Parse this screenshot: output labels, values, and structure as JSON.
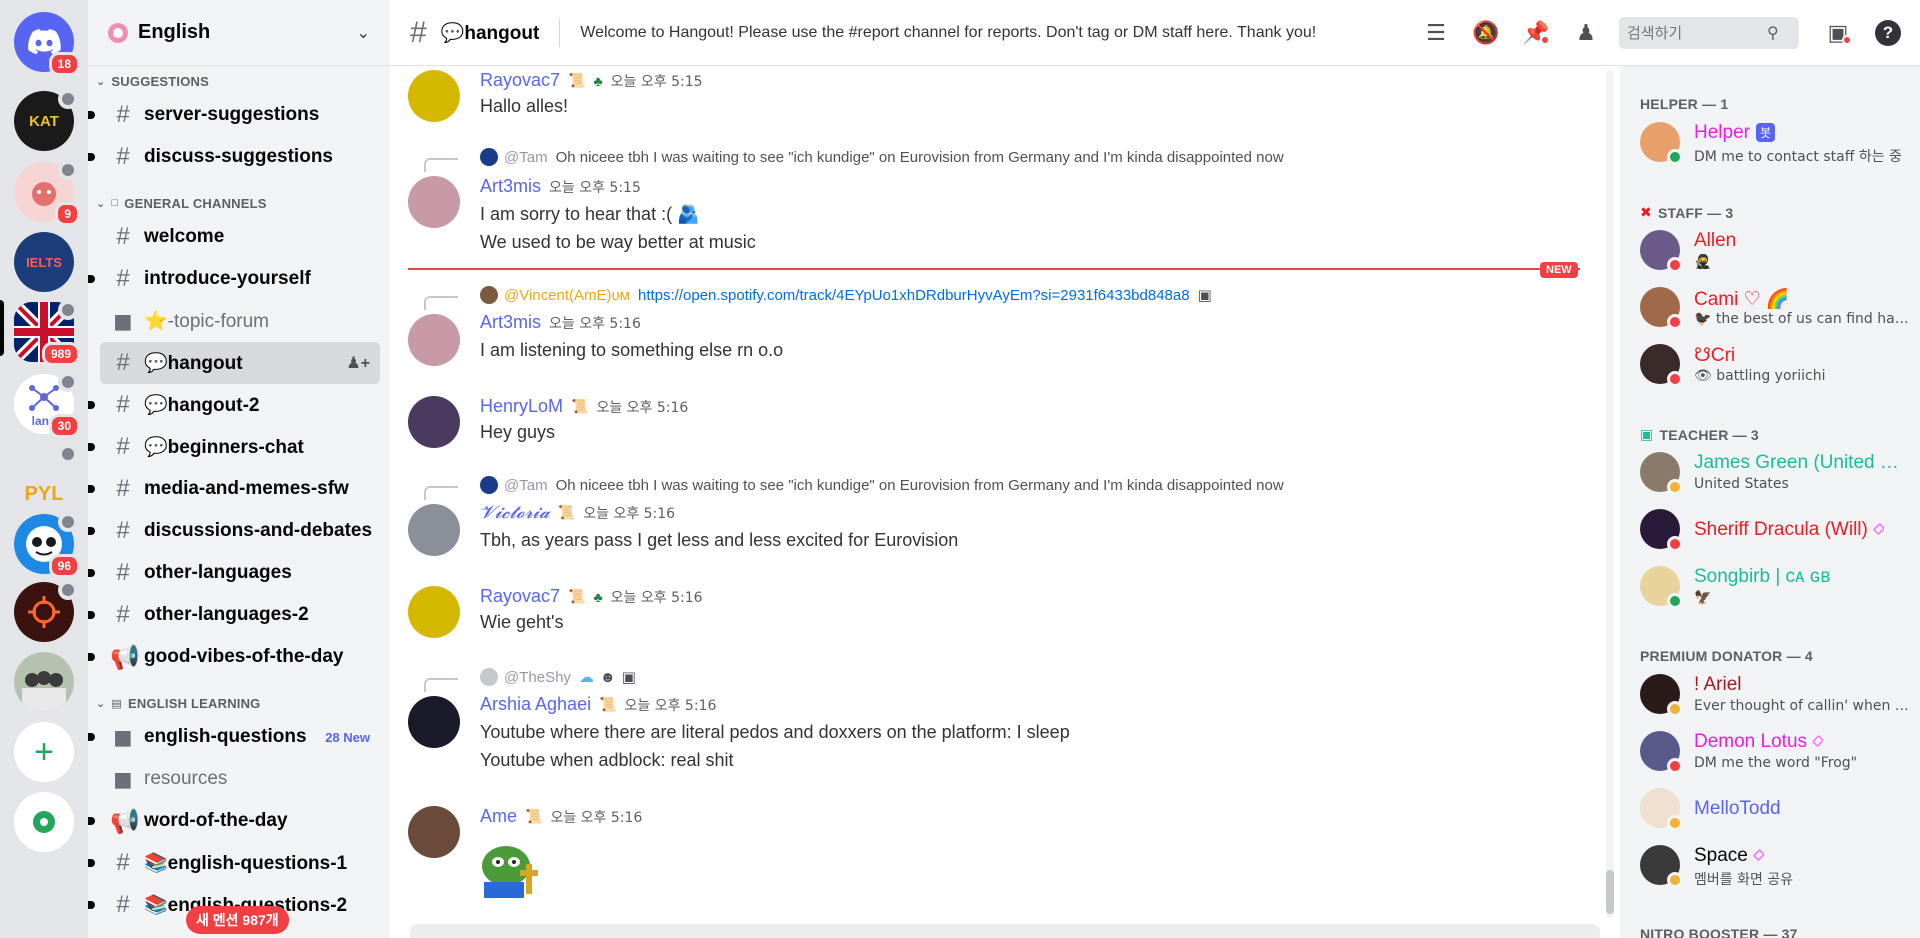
{
  "servers": {
    "home_badge": "18",
    "items": [
      {
        "badge": "",
        "label": "KAT"
      },
      {
        "badge": "9",
        "label": ""
      },
      {
        "badge": "",
        "label": "IELTS"
      },
      {
        "badge": "989",
        "label": ""
      },
      {
        "badge": "30",
        "label": "lang"
      },
      {
        "badge": "",
        "label": "PYL"
      },
      {
        "badge": "96",
        "label": ""
      },
      {
        "badge": "",
        "label": ""
      },
      {
        "badge": "",
        "label": ""
      }
    ]
  },
  "guild": {
    "name": "English"
  },
  "sidebar": {
    "categories": {
      "suggestions": "SUGGESTIONS",
      "general": "GENERAL CHANNELS",
      "learning": "ENGLISH LEARNING"
    },
    "channels": {
      "server_suggestions": "server-suggestions",
      "discuss_suggestions": "discuss-suggestions",
      "welcome": "welcome",
      "introduce": "introduce-yourself",
      "topic_forum": "⭐-topic-forum",
      "hangout": "💬hangout",
      "hangout2": "💬hangout-2",
      "beginners": "💬beginners-chat",
      "media": "media-and-memes-sfw",
      "discussions": "discussions-and-debates",
      "other_lang": "other-languages",
      "other_lang2": "other-languages-2",
      "good_vibes": "good-vibes-of-the-day",
      "english_questions": "english-questions",
      "english_questions_new": "28 New",
      "resources": "resources",
      "word_of_day": "word-of-the-day",
      "english_questions_1": "📚english-questions-1",
      "english_questions_2": "📚english-questions-2"
    },
    "mention_pill": "새 멘션 987개"
  },
  "header": {
    "channel": "💬hangout",
    "topic": "Welcome to Hangout! Please use the #report channel for reports. Don't tag or DM staff here. Thank you!",
    "search_placeholder": "검색하기"
  },
  "messages": [
    {
      "author": "Rayovac7",
      "time": "오늘 오후 5:15",
      "color": "#5865f2",
      "lines": [
        "Hallo alles!"
      ]
    },
    {
      "reply_to": "@Tam",
      "reply_text": "Oh niceee tbh I was waiting to see \"ich kundige\" on Eurovision from Germany and I'm kinda disappointed now",
      "author": "Art3mis",
      "time": "오늘 오후 5:15",
      "color": "#5865f2",
      "lines": [
        "I am sorry to hear that :( 🫂",
        "We used to be way better at music"
      ]
    },
    {
      "reply_to": "@Vincent(AmE)ᴜᴍ",
      "reply_link": "https://open.spotify.com/track/4EYpUo1xhDRdburHyvAyEm?si=2931f6433bd848a8",
      "author": "Art3mis",
      "time": "오늘 오후 5:16",
      "color": "#5865f2",
      "lines": [
        "I am listening to something else rn o.o"
      ]
    },
    {
      "author": "HenryLoM",
      "time": "오늘 오후 5:16",
      "color": "#5865f2",
      "lines": [
        "Hey guys"
      ]
    },
    {
      "reply_to": "@Tam",
      "reply_text": "Oh niceee tbh I was waiting to see \"ich kundige\" on Eurovision from Germany and I'm kinda disappointed now",
      "author": "𝓥𝓲𝓬𝓽𝓸𝓻𝓲𝓪",
      "time": "오늘 오후 5:16",
      "color": "#5865f2",
      "lines": [
        "Tbh, as years pass I get less and less excited for Eurovision"
      ]
    },
    {
      "author": "Rayovac7",
      "time": "오늘 오후 5:16",
      "color": "#5865f2",
      "lines": [
        "Wie geht's"
      ]
    },
    {
      "reply_to": "@TheShy",
      "reply_text": "☁",
      "author": "Arshia Aghaei",
      "time": "오늘 오후 5:16",
      "color": "#5865f2",
      "lines": [
        "Youtube where there are literal pedos and doxxers on the platform: I sleep",
        "Youtube when adblock: real shit"
      ]
    },
    {
      "author": "Ame",
      "time": "오늘 오후 5:16",
      "color": "#5865f2",
      "lines": []
    }
  ],
  "new_divider": "NEW",
  "members": {
    "helper_cat": "HELPER — 1",
    "staff_cat": "STAFF — 3",
    "teacher_cat": "TEACHER — 3",
    "donator_cat": "PREMIUM DONATOR — 4",
    "booster_cat": "NITRO BOOSTER — 37",
    "helper": [
      {
        "name": "Helper",
        "badge": "봇",
        "status": "DM me to contact staff 하는 중",
        "color": "#e91ee0"
      }
    ],
    "staff": [
      {
        "name": "Allen",
        "status": "🥷",
        "color": "#ed1c24"
      },
      {
        "name": "Cami ♡ 🌈",
        "status": "🐦‍⬛ the best of us can find happiness in misery",
        "color": "#ed1c24"
      },
      {
        "name": "☋Cri",
        "status": "👁 battling yoriichi",
        "color": "#ed1c24"
      }
    ],
    "teacher": [
      {
        "name": "James Green (United States)",
        "status": "United States",
        "color": "#1abc9c"
      },
      {
        "name": "Sheriff Dracula (Will)",
        "status": "",
        "color": "#ed1c24"
      },
      {
        "name": "Songbirb | ᴄᴀ ɢʙ",
        "status": "🦅",
        "color": "#1abc9c"
      }
    ],
    "donator": [
      {
        "name": "! Ariel",
        "status": "Ever thought of callin' when you've had a few?",
        "color": "#9c1c1c"
      },
      {
        "name": "Demon Lotus",
        "status": "DM me the word \"Frog\"",
        "color": "#e91ee0"
      },
      {
        "name": "MelloTodd",
        "status": "",
        "color": "#5865f2"
      },
      {
        "name": "Space",
        "status": "멤버를 화면 공유",
        "color": "#060607"
      }
    ]
  }
}
